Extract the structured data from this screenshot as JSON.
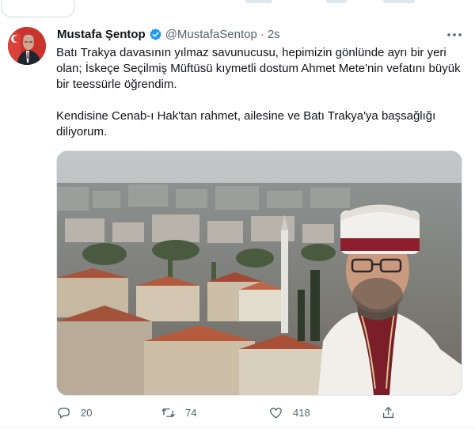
{
  "tweet": {
    "author": {
      "name": "Mustafa Şentop",
      "handle": "@MustafaSentop",
      "separator": "·",
      "time": "2s"
    },
    "text": "Batı Trakya davasının yılmaz savunucusu, hepimizin gönlünde ayrı bir yeri olan; İskeçe Seçilmiş Müftüsü kıymetli dostum Ahmet Mete'nin vefatını büyük bir teessürle öğrendim.\n\nKendisine Cenab-ı Hak'tan rahmet, ailesine ve Batı Trakya'ya başsağlığı diliyorum.",
    "stats": {
      "replies": "20",
      "retweets": "74",
      "likes": "418"
    }
  },
  "colors": {
    "text": "#0f1419",
    "muted": "#536471",
    "verified": "#1d9bf0"
  },
  "icons": [
    "verified-badge-icon",
    "more-icon",
    "reply-icon",
    "retweet-icon",
    "like-icon",
    "share-icon"
  ]
}
